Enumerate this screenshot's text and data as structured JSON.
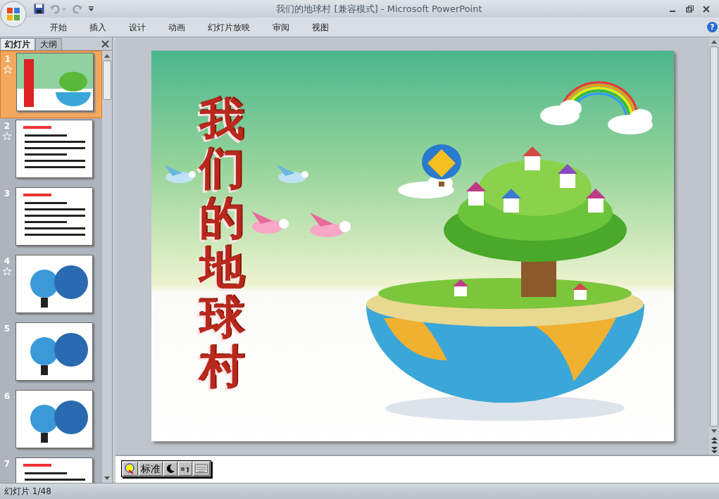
{
  "window": {
    "title": "我们的地球村 [兼容模式] - Microsoft PowerPoint"
  },
  "ribbon_tabs": [
    {
      "label": "开始",
      "selected": false
    },
    {
      "label": "插入",
      "selected": false
    },
    {
      "label": "设计",
      "selected": false
    },
    {
      "label": "动画",
      "selected": false
    },
    {
      "label": "幻灯片放映",
      "selected": false
    },
    {
      "label": "审阅",
      "selected": false
    },
    {
      "label": "视图",
      "selected": false
    }
  ],
  "panel_tabs": [
    {
      "label": "幻灯片",
      "selected": true
    },
    {
      "label": "大纲",
      "selected": false
    }
  ],
  "slides": [
    {
      "number": "1",
      "selected": true,
      "animated": true,
      "kind": "title"
    },
    {
      "number": "2",
      "selected": false,
      "animated": true,
      "kind": "text"
    },
    {
      "number": "3",
      "selected": false,
      "animated": false,
      "kind": "text"
    },
    {
      "number": "4",
      "selected": false,
      "animated": true,
      "kind": "photos"
    },
    {
      "number": "5",
      "selected": false,
      "animated": false,
      "kind": "photos"
    },
    {
      "number": "6",
      "selected": false,
      "animated": false,
      "kind": "photos"
    },
    {
      "number": "7",
      "selected": false,
      "animated": false,
      "kind": "text"
    }
  ],
  "help_button": {
    "label": "?"
  },
  "slide": {
    "title": "我们的地球村"
  },
  "ime_toolbar": {
    "mode": "标准"
  },
  "status_bar": {
    "slide_counter": "幻灯片 1/48"
  }
}
